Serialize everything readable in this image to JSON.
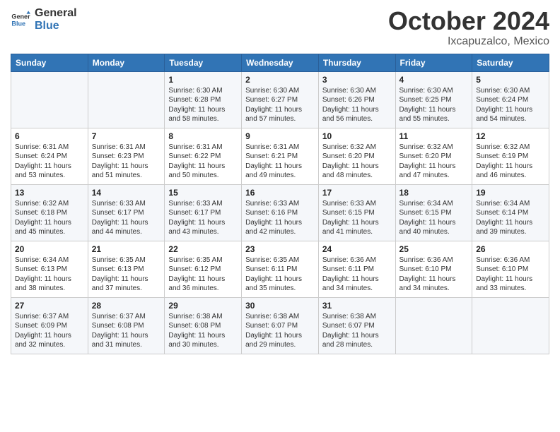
{
  "logo": {
    "line1": "General",
    "line2": "Blue"
  },
  "title": "October 2024",
  "location": "Ixcapuzalco, Mexico",
  "weekdays": [
    "Sunday",
    "Monday",
    "Tuesday",
    "Wednesday",
    "Thursday",
    "Friday",
    "Saturday"
  ],
  "weeks": [
    [
      {
        "day": "",
        "info": ""
      },
      {
        "day": "",
        "info": ""
      },
      {
        "day": "1",
        "info": "Sunrise: 6:30 AM\nSunset: 6:28 PM\nDaylight: 11 hours and 58 minutes."
      },
      {
        "day": "2",
        "info": "Sunrise: 6:30 AM\nSunset: 6:27 PM\nDaylight: 11 hours and 57 minutes."
      },
      {
        "day": "3",
        "info": "Sunrise: 6:30 AM\nSunset: 6:26 PM\nDaylight: 11 hours and 56 minutes."
      },
      {
        "day": "4",
        "info": "Sunrise: 6:30 AM\nSunset: 6:25 PM\nDaylight: 11 hours and 55 minutes."
      },
      {
        "day": "5",
        "info": "Sunrise: 6:30 AM\nSunset: 6:24 PM\nDaylight: 11 hours and 54 minutes."
      }
    ],
    [
      {
        "day": "6",
        "info": "Sunrise: 6:31 AM\nSunset: 6:24 PM\nDaylight: 11 hours and 53 minutes."
      },
      {
        "day": "7",
        "info": "Sunrise: 6:31 AM\nSunset: 6:23 PM\nDaylight: 11 hours and 51 minutes."
      },
      {
        "day": "8",
        "info": "Sunrise: 6:31 AM\nSunset: 6:22 PM\nDaylight: 11 hours and 50 minutes."
      },
      {
        "day": "9",
        "info": "Sunrise: 6:31 AM\nSunset: 6:21 PM\nDaylight: 11 hours and 49 minutes."
      },
      {
        "day": "10",
        "info": "Sunrise: 6:32 AM\nSunset: 6:20 PM\nDaylight: 11 hours and 48 minutes."
      },
      {
        "day": "11",
        "info": "Sunrise: 6:32 AM\nSunset: 6:20 PM\nDaylight: 11 hours and 47 minutes."
      },
      {
        "day": "12",
        "info": "Sunrise: 6:32 AM\nSunset: 6:19 PM\nDaylight: 11 hours and 46 minutes."
      }
    ],
    [
      {
        "day": "13",
        "info": "Sunrise: 6:32 AM\nSunset: 6:18 PM\nDaylight: 11 hours and 45 minutes."
      },
      {
        "day": "14",
        "info": "Sunrise: 6:33 AM\nSunset: 6:17 PM\nDaylight: 11 hours and 44 minutes."
      },
      {
        "day": "15",
        "info": "Sunrise: 6:33 AM\nSunset: 6:17 PM\nDaylight: 11 hours and 43 minutes."
      },
      {
        "day": "16",
        "info": "Sunrise: 6:33 AM\nSunset: 6:16 PM\nDaylight: 11 hours and 42 minutes."
      },
      {
        "day": "17",
        "info": "Sunrise: 6:33 AM\nSunset: 6:15 PM\nDaylight: 11 hours and 41 minutes."
      },
      {
        "day": "18",
        "info": "Sunrise: 6:34 AM\nSunset: 6:15 PM\nDaylight: 11 hours and 40 minutes."
      },
      {
        "day": "19",
        "info": "Sunrise: 6:34 AM\nSunset: 6:14 PM\nDaylight: 11 hours and 39 minutes."
      }
    ],
    [
      {
        "day": "20",
        "info": "Sunrise: 6:34 AM\nSunset: 6:13 PM\nDaylight: 11 hours and 38 minutes."
      },
      {
        "day": "21",
        "info": "Sunrise: 6:35 AM\nSunset: 6:13 PM\nDaylight: 11 hours and 37 minutes."
      },
      {
        "day": "22",
        "info": "Sunrise: 6:35 AM\nSunset: 6:12 PM\nDaylight: 11 hours and 36 minutes."
      },
      {
        "day": "23",
        "info": "Sunrise: 6:35 AM\nSunset: 6:11 PM\nDaylight: 11 hours and 35 minutes."
      },
      {
        "day": "24",
        "info": "Sunrise: 6:36 AM\nSunset: 6:11 PM\nDaylight: 11 hours and 34 minutes."
      },
      {
        "day": "25",
        "info": "Sunrise: 6:36 AM\nSunset: 6:10 PM\nDaylight: 11 hours and 34 minutes."
      },
      {
        "day": "26",
        "info": "Sunrise: 6:36 AM\nSunset: 6:10 PM\nDaylight: 11 hours and 33 minutes."
      }
    ],
    [
      {
        "day": "27",
        "info": "Sunrise: 6:37 AM\nSunset: 6:09 PM\nDaylight: 11 hours and 32 minutes."
      },
      {
        "day": "28",
        "info": "Sunrise: 6:37 AM\nSunset: 6:08 PM\nDaylight: 11 hours and 31 minutes."
      },
      {
        "day": "29",
        "info": "Sunrise: 6:38 AM\nSunset: 6:08 PM\nDaylight: 11 hours and 30 minutes."
      },
      {
        "day": "30",
        "info": "Sunrise: 6:38 AM\nSunset: 6:07 PM\nDaylight: 11 hours and 29 minutes."
      },
      {
        "day": "31",
        "info": "Sunrise: 6:38 AM\nSunset: 6:07 PM\nDaylight: 11 hours and 28 minutes."
      },
      {
        "day": "",
        "info": ""
      },
      {
        "day": "",
        "info": ""
      }
    ]
  ]
}
